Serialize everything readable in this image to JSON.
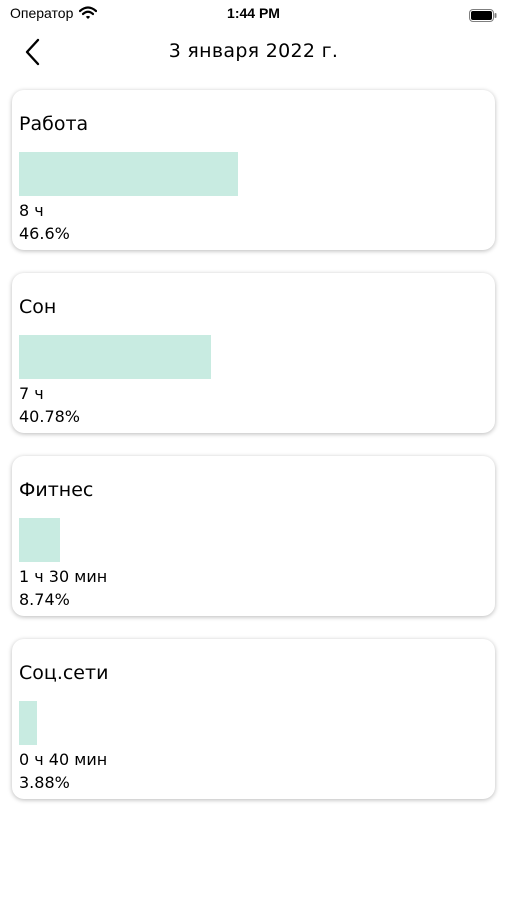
{
  "status_bar": {
    "carrier": "Оператор",
    "time": "1:44 PM"
  },
  "nav": {
    "title": "3 января 2022 г."
  },
  "accent_color": "#c8ebe1",
  "activities": [
    {
      "name": "Работа",
      "duration": "8 ч",
      "percent": "46.6%",
      "fraction": 0.466
    },
    {
      "name": "Сон",
      "duration": "7 ч",
      "percent": "40.78%",
      "fraction": 0.4078
    },
    {
      "name": "Фитнес",
      "duration": "1 ч 30 мин",
      "percent": "8.74%",
      "fraction": 0.0874
    },
    {
      "name": "Соц.сети",
      "duration": "0 ч 40 мин",
      "percent": "3.88%",
      "fraction": 0.0388
    }
  ]
}
